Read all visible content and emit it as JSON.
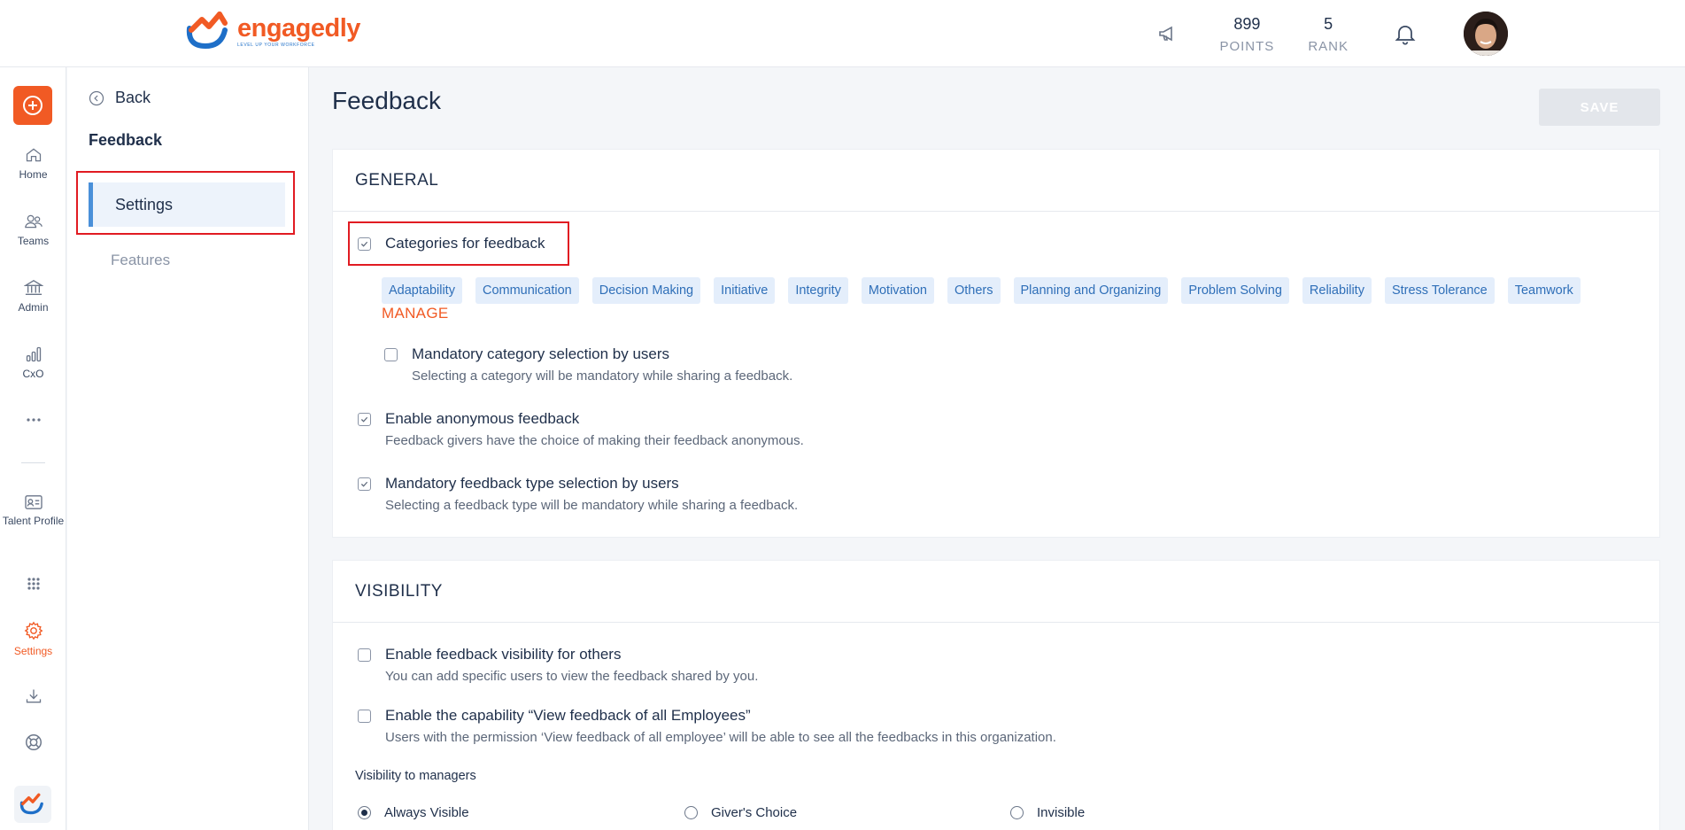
{
  "brand": {
    "name": "engagedly",
    "tagline": "LEVEL UP YOUR WORKFORCE",
    "accent": "#f15a24",
    "primary_blue": "#1e6fc8"
  },
  "header": {
    "announcement_icon": "megaphone-icon",
    "points": {
      "value": "899",
      "label": "POINTS"
    },
    "rank": {
      "value": "5",
      "label": "RANK"
    },
    "notification_icon": "bell-icon"
  },
  "rail": {
    "add_icon": "plus-circle-icon",
    "items": [
      {
        "label": "Home",
        "icon": "home-icon"
      },
      {
        "label": "Teams",
        "icon": "teams-icon"
      },
      {
        "label": "Admin",
        "icon": "bank-icon"
      },
      {
        "label": "CxO",
        "icon": "bar-chart-icon"
      },
      {
        "label": "Talent Profile",
        "icon": "id-card-icon"
      },
      {
        "label": "Settings",
        "icon": "gear-icon",
        "active": true
      }
    ]
  },
  "subnav": {
    "back_label": "Back",
    "title": "Feedback",
    "items": [
      {
        "label": "Settings",
        "active": true
      },
      {
        "label": "Features",
        "active": false
      }
    ]
  },
  "page": {
    "title": "Feedback",
    "save_label": "SAVE"
  },
  "general": {
    "heading": "GENERAL",
    "categories": {
      "label": "Categories for feedback",
      "checked": true,
      "chips": [
        "Adaptability",
        "Communication",
        "Decision Making",
        "Initiative",
        "Integrity",
        "Motivation",
        "Others",
        "Planning and Organizing",
        "Problem Solving",
        "Reliability",
        "Stress Tolerance",
        "Teamwork"
      ],
      "manage_label": "MANAGE"
    },
    "mandatory_category": {
      "label": "Mandatory category selection by users",
      "desc": "Selecting a category will be mandatory while sharing a feedback.",
      "checked": false
    },
    "anonymous": {
      "label": "Enable anonymous feedback",
      "desc": "Feedback givers have the choice of making their feedback anonymous.",
      "checked": true
    },
    "mandatory_type": {
      "label": "Mandatory feedback type selection by users",
      "desc": "Selecting a feedback type will be mandatory while sharing a feedback.",
      "checked": true
    }
  },
  "visibility": {
    "heading": "VISIBILITY",
    "others": {
      "label": "Enable feedback visibility for others",
      "desc": "You can add specific users to view the feedback shared by you.",
      "checked": false
    },
    "all_employees": {
      "label": "Enable the capability “View feedback of all Employees”",
      "desc": "Users with the permission ‘View feedback of all employee’ will be able to see all the feedbacks in this organization.",
      "checked": false
    },
    "managers_label": "Visibility to managers",
    "managers_options": [
      {
        "label": "Always Visible",
        "selected": true
      },
      {
        "label": "Giver's Choice",
        "selected": false
      },
      {
        "label": "Invisible",
        "selected": false
      }
    ]
  }
}
